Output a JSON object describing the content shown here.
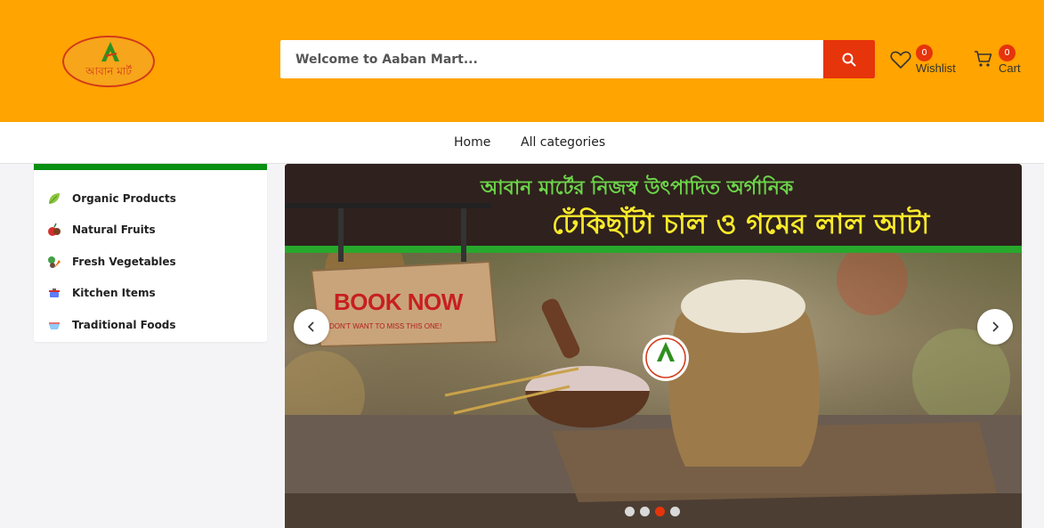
{
  "header": {
    "logo_text": "আবান মার্ট",
    "search": {
      "placeholder": "Welcome to Aaban Mart..."
    },
    "wishlist": {
      "label": "Wishlist",
      "count": "0"
    },
    "cart": {
      "label": "Cart",
      "count": "0"
    }
  },
  "nav": {
    "items": [
      {
        "label": "Home"
      },
      {
        "label": "All categories"
      }
    ]
  },
  "sidebar": {
    "items": [
      {
        "label": "Organic Products",
        "icon": "leaf-icon"
      },
      {
        "label": "Natural Fruits",
        "icon": "fruit-icon"
      },
      {
        "label": "Fresh Vegetables",
        "icon": "vegetable-icon"
      },
      {
        "label": "Kitchen Items",
        "icon": "kitchen-pot-icon"
      },
      {
        "label": "Traditional Foods",
        "icon": "traditional-food-icon"
      }
    ]
  },
  "banner": {
    "headline_1": "আবান মার্টের নিজস্ব উৎপাদিত অর্গানিক",
    "headline_2": "ঢেঁকিছাঁটা চাল ও গমের লাল আটা",
    "sign_text": "BOOK NOW",
    "sign_subtext": "DON'T WANT TO MISS THIS ONE!",
    "slides_count": 4,
    "active_slide": 3
  },
  "colors": {
    "header_bg": "#ffa400",
    "accent": "#e6340b",
    "sidebar_top_border": "#079011",
    "headline_1": "#6cd44a",
    "headline_2": "#f8ea2b"
  }
}
